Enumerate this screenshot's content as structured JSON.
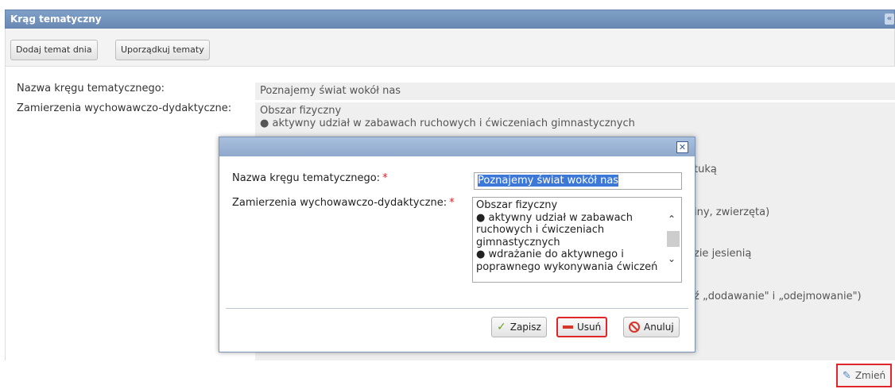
{
  "panel": {
    "title": "Krąg tematyczny"
  },
  "toolbar": {
    "add_label": "Dodaj temat dnia",
    "order_label": "Uporządkuj tematy"
  },
  "background_form": {
    "name_label": "Nazwa kręgu tematycznego:",
    "name_value": "Poznajemy świat wokół nas",
    "goals_label": "Zamierzenia wychowawczo-dydaktyczne:",
    "goals_lines": [
      "Obszar fizyczny",
      "● aktywny udział w zabawach ruchowych i ćwiczeniach gimnastycznych"
    ],
    "visible_fragments": [
      "tuką",
      "iny, zwierzęta)",
      "zie jesienią",
      "ź „dodawanie\" i „odejmowanie\")"
    ],
    "edit_label": "Zmień"
  },
  "modal": {
    "close_label": "✕",
    "name_label": "Nazwa kręgu tematycznego:",
    "name_value": "Poznajemy świat wokół nas",
    "goals_label": "Zamierzenia wychowawczo-dydaktyczne:",
    "required_mark": "*",
    "goals_lines": [
      "Obszar fizyczny",
      "● aktywny udział w zabawach",
      "ruchowych i ćwiczeniach",
      "gimnastycznych",
      "● wdrażanie do aktywnego i",
      "poprawnego wykonywania ćwiczeń"
    ],
    "save_label": "Zapisz",
    "delete_label": "Usuń",
    "cancel_label": "Anuluj"
  }
}
